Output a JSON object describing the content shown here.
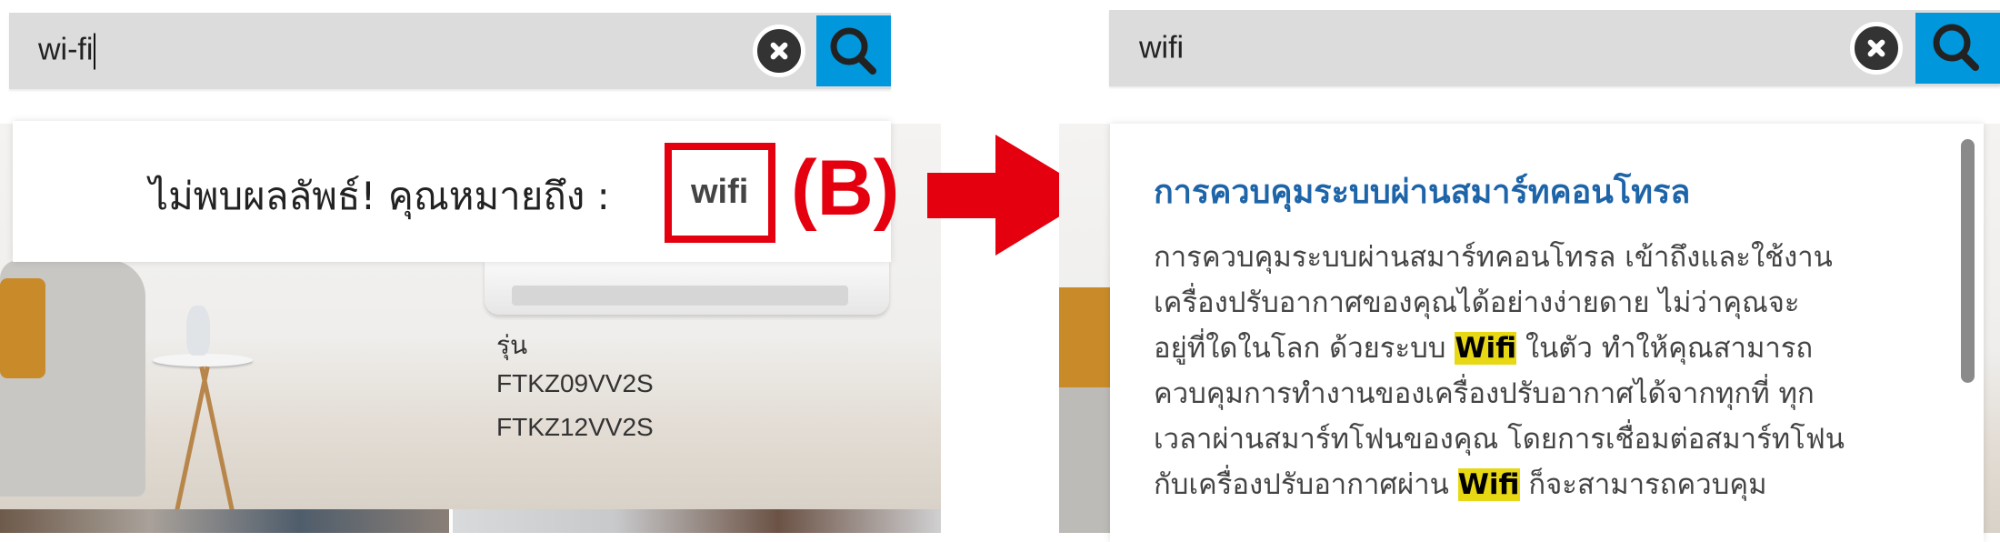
{
  "left_panel": {
    "search": {
      "value": "wi-fi",
      "clear_icon": "close-circle-icon",
      "search_icon": "magnifier-icon"
    },
    "no_result_text": "ไม่พบผลลัพธ์! คุณหมายถึง :",
    "suggestion": "wifi",
    "annotation_label": "(B)",
    "product": {
      "model_label": "รุ่น",
      "models": [
        "FTKZ09VV2S",
        "FTKZ12VV2S"
      ]
    }
  },
  "arrow": {
    "icon": "arrow-right-icon",
    "color": "#e5000f"
  },
  "right_panel": {
    "search": {
      "value": "wifi",
      "clear_icon": "close-circle-icon",
      "search_icon": "magnifier-icon"
    },
    "result": {
      "title": "การควบคุมระบบผ่านสมาร์ทคอนโทรล",
      "lines": [
        {
          "before": "การควบคุมระบบผ่านสมาร์ทคอนโทรล เข้าถึงและใช้งาน",
          "highlight": "",
          "after": ""
        },
        {
          "before": "เครื่องปรับอากาศของคุณได้อย่างง่ายดาย ไม่ว่าคุณจะ",
          "highlight": "",
          "after": ""
        },
        {
          "before": "อยู่ที่ใดในโลก ด้วยระบบ ",
          "highlight": "Wifi",
          "after": " ในตัว ทำให้คุณสามารถ"
        },
        {
          "before": "ควบคุมการทำงานของเครื่องปรับอากาศได้จากทุกที่ ทุก",
          "highlight": "",
          "after": ""
        },
        {
          "before": "เวลาผ่านสมาร์ทโฟนของคุณ โดยการเชื่อมต่อสมาร์ทโฟน",
          "highlight": "",
          "after": ""
        },
        {
          "before": "กับเครื่องปรับอากาศผ่าน ",
          "highlight": "Wifi",
          "after": " ก็จะสามารถควบคุม"
        }
      ]
    }
  },
  "colors": {
    "search_button": "#0097dc",
    "title": "#1d64a8",
    "highlight": "#e8d814",
    "annotation": "#e5000f"
  }
}
